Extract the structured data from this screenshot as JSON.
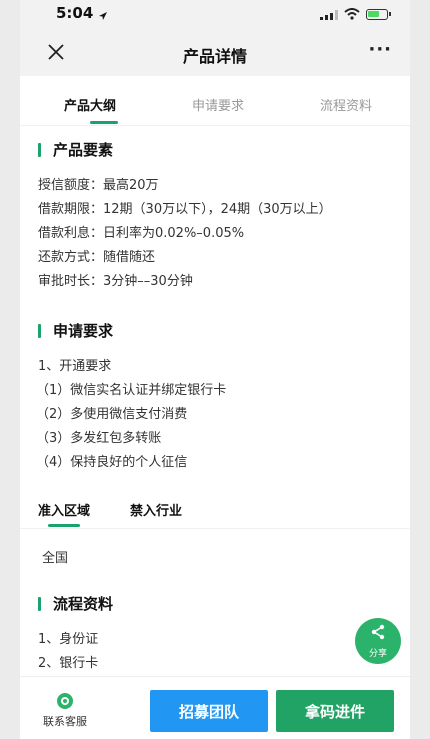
{
  "status": {
    "time": "5:04"
  },
  "nav": {
    "title": "产品详情",
    "more": "···"
  },
  "tabs": [
    {
      "label": "产品大纲"
    },
    {
      "label": "申请要求"
    },
    {
      "label": "流程资料"
    }
  ],
  "product": {
    "title": "产品要素",
    "lines": [
      "授信额度：最高20万",
      "借款期限：12期（30万以下），24期（30万以上）",
      "借款利息：日利率为0.02%–0.05%",
      "还款方式：随借随还",
      "审批时长：3分钟––30分钟"
    ]
  },
  "apply": {
    "title": "申请要求",
    "heading": "1、开通要求",
    "items": [
      "（1）微信实名认证并绑定银行卡",
      "（2）多使用微信支付消费",
      "（3）多发红包多转账",
      "（4）保持良好的个人征信"
    ]
  },
  "subtabs": [
    {
      "label": "准入区域"
    },
    {
      "label": "禁入行业"
    }
  ],
  "region": {
    "value": "全国"
  },
  "process": {
    "title": "流程资料",
    "items": [
      "1、身份证",
      "2、银行卡"
    ]
  },
  "share": {
    "label": "分享"
  },
  "bottom": {
    "service_label": "联系客服",
    "recruit_label": "招募团队",
    "code_label": "拿码进件"
  },
  "colors": {
    "accent": "#1aa36f",
    "blue": "#2196f3",
    "green": "#21a366"
  }
}
